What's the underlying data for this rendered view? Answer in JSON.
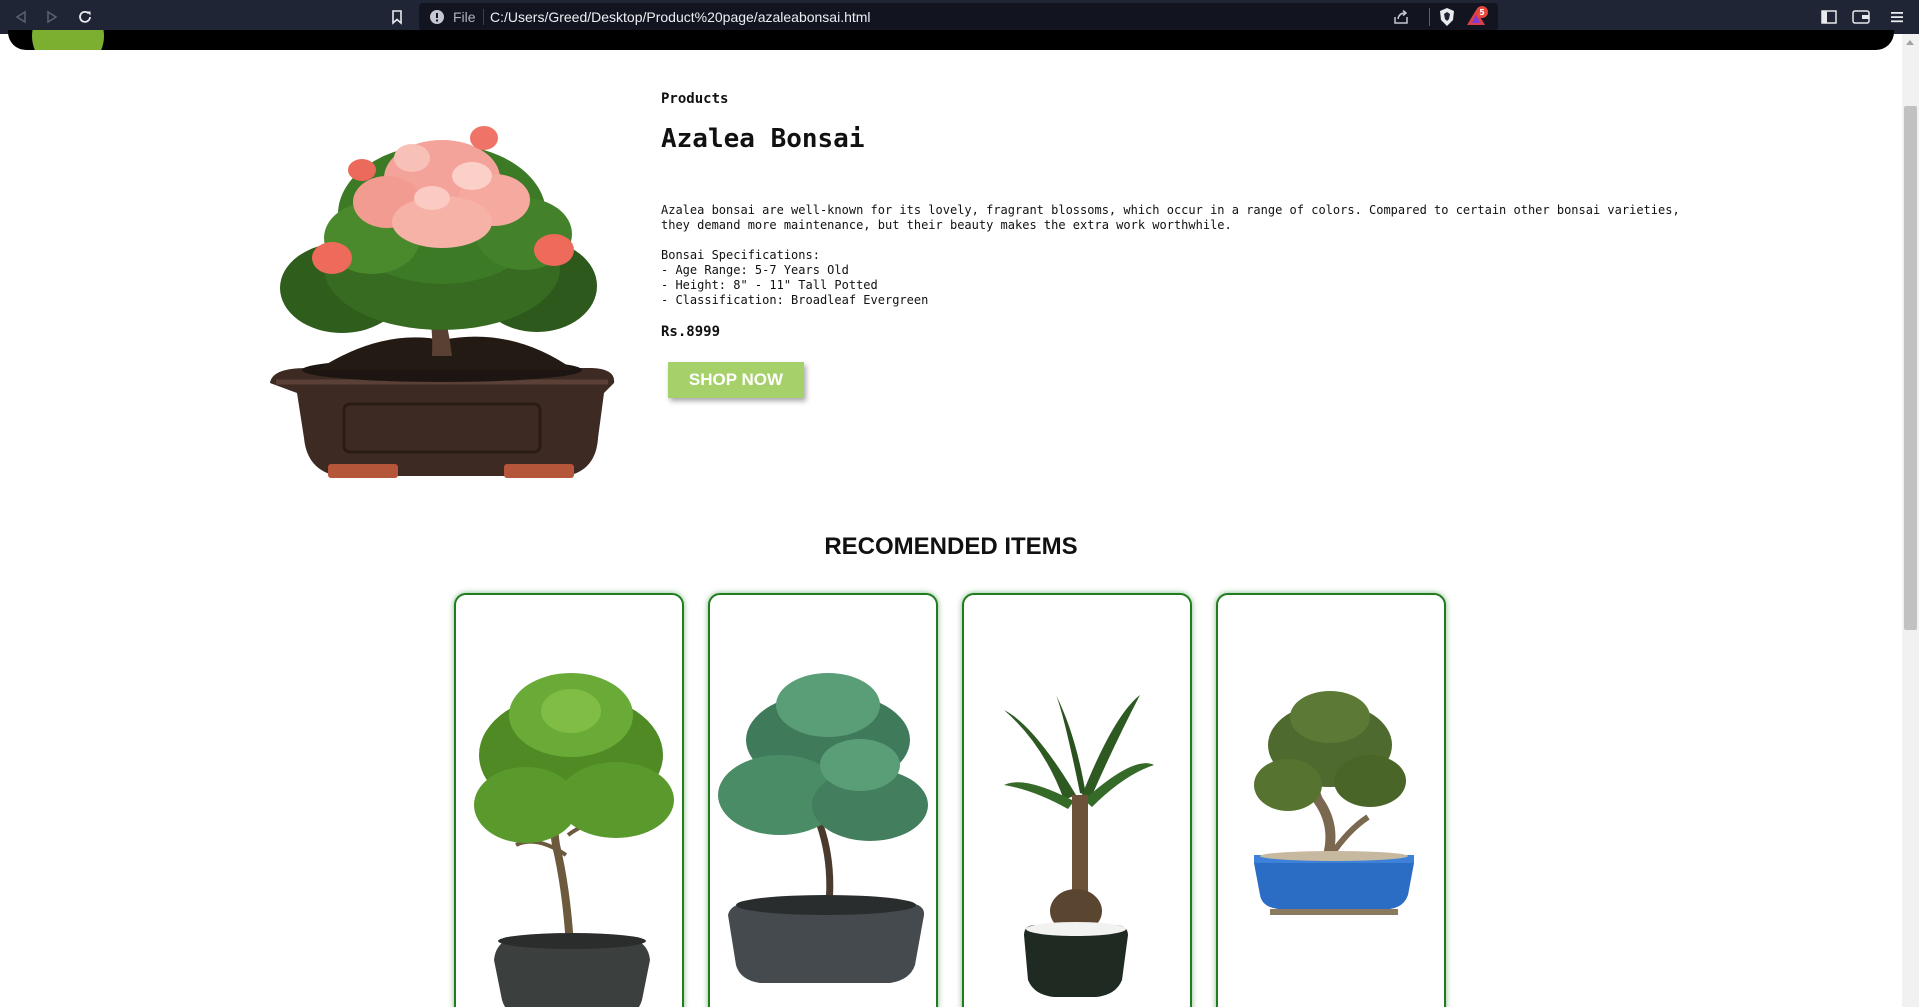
{
  "browser": {
    "address": {
      "scheme_label": "File",
      "url": "C:/Users/Greed/Desktop/Product%20page/azaleabonsai.html"
    },
    "rewards_badge": "5",
    "colors": {
      "toolbar": "#202535",
      "address_bar": "#12151f"
    }
  },
  "product": {
    "breadcrumb": "Products",
    "title": "Azalea Bonsai",
    "description": "Azalea bonsai are well-known for its lovely, fragrant blossoms, which occur in a range of colors. Compared to certain other bonsai varieties, they demand more maintenance, but their beauty makes the extra work worthwhile.",
    "specs_heading": "Bonsai Specifications:",
    "specs": [
      "- Age Range: 5-7 Years Old",
      "- Height: 8\" - 11\" Tall Potted",
      "- Classification: Broadleaf Evergreen"
    ],
    "price": "Rs.8999",
    "shop_button": "SHOP NOW",
    "image_icon": "azalea-bonsai-image"
  },
  "recommended": {
    "heading": "RECOMENDED ITEMS",
    "items": [
      {
        "icon": "boxwood-bonsai-image"
      },
      {
        "icon": "pine-bonsai-image"
      },
      {
        "icon": "sago-palm-bonsai-image"
      },
      {
        "icon": "olive-bonsai-image"
      }
    ]
  },
  "colors": {
    "accent_green": "#a6d06a",
    "card_border": "#1f7d1f",
    "logo_green": "#7cae2f"
  }
}
